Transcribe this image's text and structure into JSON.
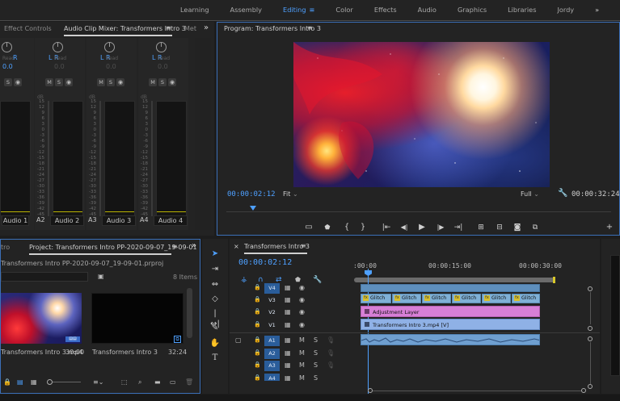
{
  "workspaces": {
    "tabs": [
      "Learning",
      "Assembly",
      "Editing",
      "Color",
      "Effects",
      "Audio",
      "Graphics",
      "Libraries",
      "Jordy"
    ],
    "active": "Editing",
    "overflow": "»"
  },
  "mixer": {
    "tabs": [
      "Effect Controls",
      "Audio Clip Mixer: Transformers Intro 3",
      "Met"
    ],
    "menu_icon": "≡",
    "overflow": "»",
    "channels": [
      {
        "lbl": "",
        "name": "Audio 1",
        "pan": "R",
        "zero": "0.0"
      },
      {
        "lbl": "A2",
        "name": "Audio 2",
        "pan": "L  R",
        "zero": "0.0"
      },
      {
        "lbl": "A3",
        "name": "Audio 3",
        "pan": "L  R",
        "zero": "0.0"
      },
      {
        "lbl": "A4",
        "name": "Audio 4",
        "pan": "L  R",
        "zero": "0.0"
      }
    ],
    "read_label": "Read",
    "db_label": "dB",
    "scale": [
      "15",
      "12",
      "9",
      "6",
      "3",
      "0",
      "-3",
      "-6",
      "-9",
      "-12",
      "-15",
      "-18",
      "-21",
      "-24",
      "-27",
      "-30",
      "-33",
      "-36",
      "-39",
      "-42",
      "-45",
      "-48",
      "-51",
      "-54",
      "-57",
      "dB"
    ],
    "mute_label": "M",
    "solo_label": "S"
  },
  "program": {
    "title": "Program: Transformers Intro 3",
    "menu_icon": "≡",
    "timecode": "00:00:02:12",
    "fit": "Fit",
    "quality": "Full",
    "duration": "00:00:32:24",
    "playhead_fraction": 0.07
  },
  "project": {
    "tabs": [
      "tro",
      "Project: Transformers Intro PP-2020-09-07_19-09-01"
    ],
    "menu_icon": "≡",
    "overflow": "»",
    "file": "Transformers Intro PP-2020-09-07_19-09-01.prproj",
    "items_count": "8 Items",
    "items": [
      {
        "name": "Transformers Intro 3.mp4",
        "duration": "30:00"
      },
      {
        "name": "Transformers Intro 3",
        "duration": "32:24"
      }
    ]
  },
  "timeline": {
    "close_icon": "×",
    "title": "Transformers Intro 3",
    "menu_icon": "≡",
    "timecode": "00:00:02:12",
    "ruler": [
      ":00:00",
      "00:00:15:00",
      "00:00:30:00"
    ],
    "video_tracks": [
      "V4",
      "V3",
      "V2",
      "V1"
    ],
    "audio_tracks": [
      "A1",
      "A2",
      "A3",
      "A4"
    ],
    "clips": {
      "glitch": [
        "Glitch",
        "Glitch",
        "Glitch",
        "Glitch",
        "Glitch",
        "Glitch",
        "Glitch"
      ],
      "adjustment": "Adjustment Layer",
      "video": "Transformers Intro 3.mp4 [V]"
    },
    "mute": "M",
    "solo": "S"
  },
  "colors": {
    "accent": "#4ea0ff",
    "adjustment": "#d77fd6",
    "video_clip": "#8fb1e6",
    "audio_clip": "#6f9fd0",
    "glitch": "#7fb0d6"
  }
}
